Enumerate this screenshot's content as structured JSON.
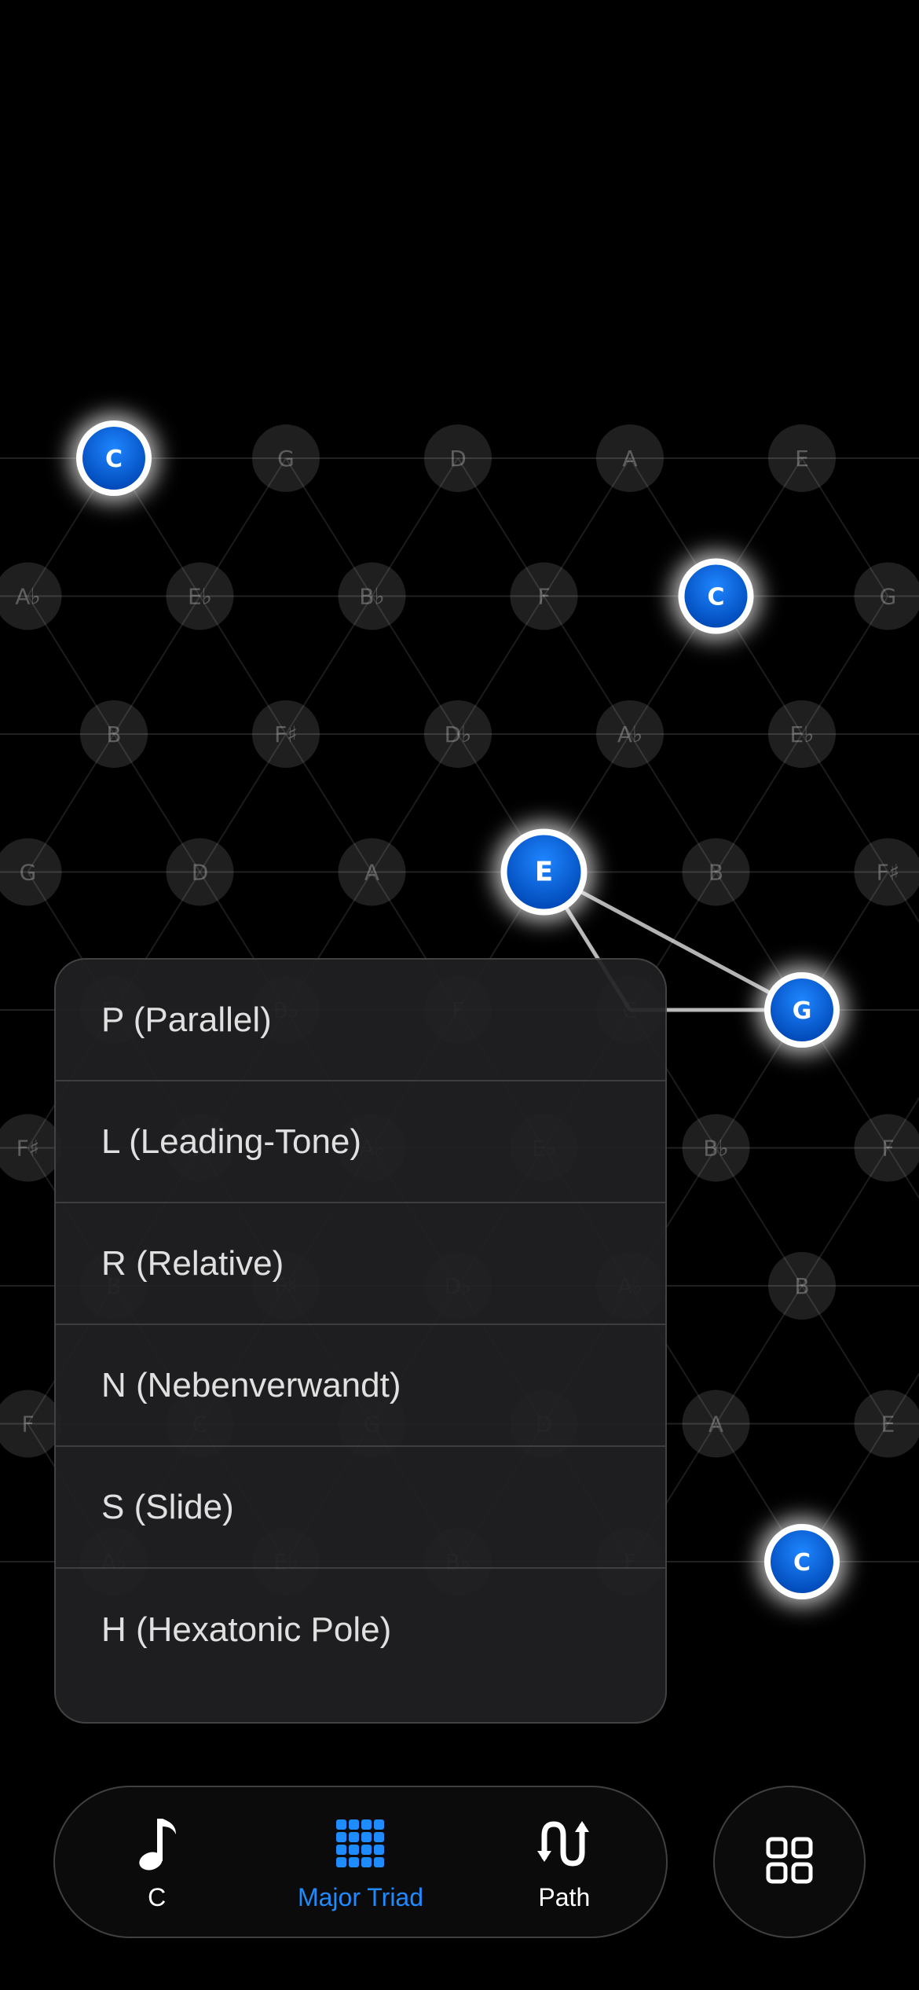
{
  "lattice": {
    "rows": [
      [
        "C",
        "G",
        "D",
        "A",
        "E"
      ],
      [
        "A♭",
        "E♭",
        "B♭",
        "F",
        "C",
        "G"
      ],
      [
        "B",
        "F♯",
        "D♭",
        "A♭",
        "E♭"
      ],
      [
        "G",
        "D",
        "A",
        "E",
        "B",
        "F♯"
      ],
      [
        "E♭",
        "B♭",
        "F",
        "C",
        "G",
        "D"
      ],
      [
        "F♯",
        "D♭",
        "A♭",
        "E♭",
        "B♭",
        "F"
      ],
      [
        "B",
        "F♯",
        "D♭",
        "A♭",
        "B",
        "F♯",
        "D♭"
      ],
      [
        "F",
        "C",
        "G",
        "D",
        "A",
        "E"
      ],
      [
        "A♭",
        "E♭",
        "B♭",
        "F",
        "C"
      ]
    ],
    "highlighted_notes": [
      "C",
      "E",
      "G"
    ],
    "accent_color": "#0a6fe8"
  },
  "menu": {
    "items": [
      "P (Parallel)",
      "L (Leading-Tone)",
      "R (Relative)",
      "N (Nebenverwandt)",
      "S (Slide)",
      "H (Hexatonic Pole)"
    ]
  },
  "tabbar": {
    "note": {
      "label": "C",
      "icon": "music-note-icon"
    },
    "chord": {
      "label": "Major Triad",
      "icon": "grid-dots-icon",
      "active": true
    },
    "path": {
      "label": "Path",
      "icon": "path-arrows-icon"
    }
  },
  "grid_button": {
    "icon": "four-squares-icon"
  },
  "colors": {
    "active_tab": "#1e8bff",
    "background": "#000000"
  }
}
